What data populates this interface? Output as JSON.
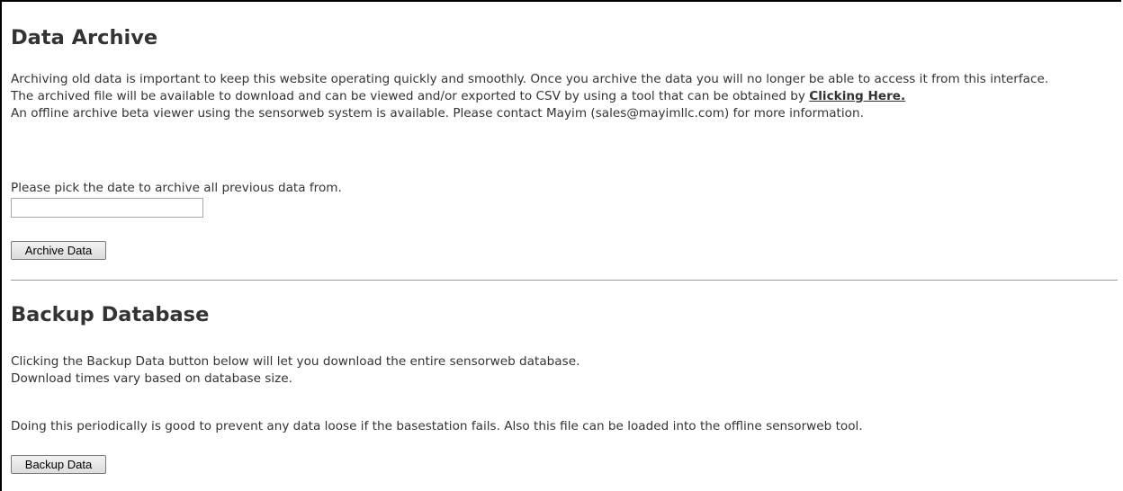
{
  "archive": {
    "heading": "Data Archive",
    "line1": "Archiving old data is important to keep this website operating quickly and smoothly. Once you archive the data you will no longer be able to access it from this interface.",
    "line2_text": "The archived file will be available to download and can be viewed and/or exported to CSV by using a tool that can be obtained by ",
    "line2_link": "Clicking Here.",
    "line3": "An offline archive beta viewer using the sensorweb system is available. Please contact Mayim (sales@mayimllc.com) for more information.",
    "pick_label": "Please pick the date to archive all previous data from.",
    "date_value": "",
    "button_label": "Archive Data"
  },
  "backup": {
    "heading": "Backup Database",
    "line1": "Clicking the Backup Data button below will let you download the entire sensorweb database.",
    "line2": "Download times vary based on database size.",
    "line3": "Doing this periodically is good to prevent any data loose if the basestation fails. Also this file can be loaded into the offline sensorweb tool.",
    "button_label": "Backup Data"
  }
}
